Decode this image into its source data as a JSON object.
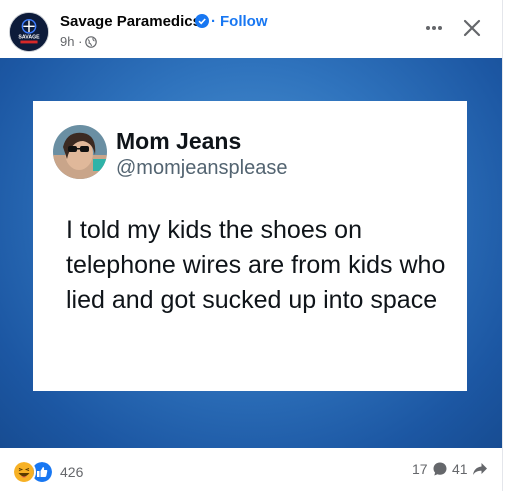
{
  "post": {
    "page_name": "Savage Paramedics",
    "separator": "·",
    "follow_label": "Follow",
    "timestamp": "9h ·",
    "avatar_text": "SAVAGE"
  },
  "tweet": {
    "author_name": "Mom Jeans",
    "handle": "@momjeansplease",
    "text": "I told my kids the shoes on telephone wires are from kids who lied and got sucked up into space"
  },
  "footer": {
    "reaction_count": "426",
    "comment_count": "17",
    "share_count": "41"
  },
  "colors": {
    "accent": "#1877f2",
    "media_bg": "#2f73bd"
  },
  "icons": [
    "verified-badge-icon",
    "globe-icon",
    "more-options-icon",
    "close-icon",
    "haha-reaction-icon",
    "like-reaction-icon",
    "comment-icon",
    "share-icon"
  ]
}
